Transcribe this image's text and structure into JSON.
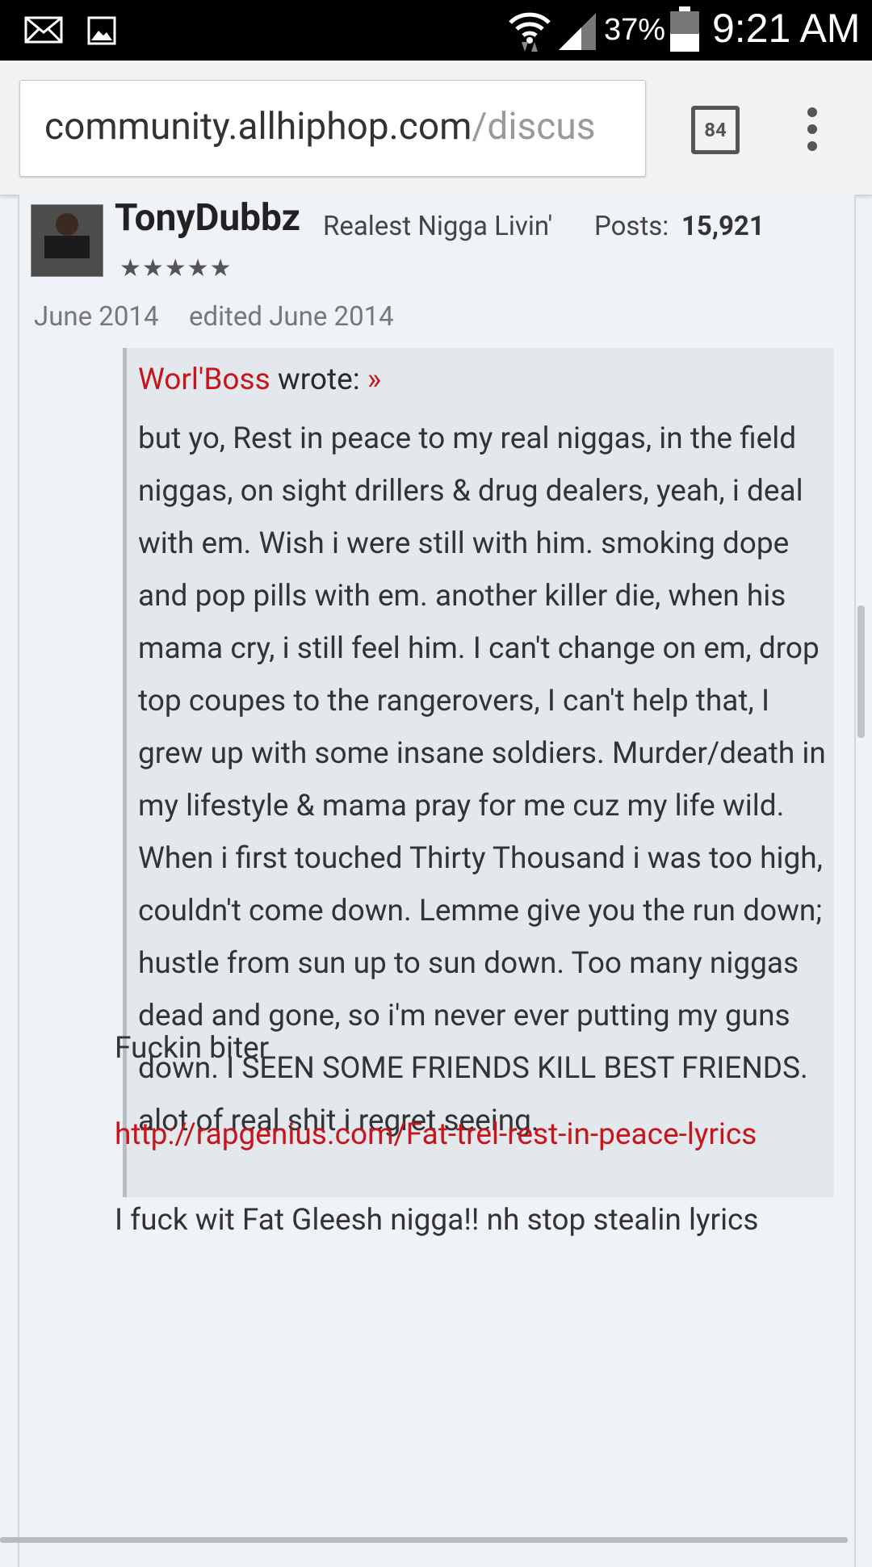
{
  "status_bar": {
    "icons": [
      "mail-icon",
      "image-icon",
      "wifi-icon",
      "signal-icon",
      "battery-icon"
    ],
    "battery": "37%",
    "time": "9:21 AM"
  },
  "browser": {
    "url_host": "community.allhiphop.com",
    "url_path": "/discus",
    "tab_count": "84"
  },
  "post": {
    "username": "TonyDubbz",
    "rank": "Realest Nigga Livin'",
    "posts_label": "Posts:",
    "posts_count": "15,921",
    "stars": "★★★★★",
    "date": "June 2014",
    "edited": "edited June 2014",
    "quote": {
      "author": "Worl'Boss",
      "wrote": "wrote:",
      "arrow": "»",
      "body": "but yo, Rest in peace to my real niggas, in the field niggas, on sight drillers & drug dealers, yeah, i deal with em. Wish i were still with him. smoking dope and pop pills with em. another killer die, when his mama cry, i still feel him. I can't change on em, drop top coupes to the rangerovers, I can't help that, I grew up with some insane soldiers. Murder/death in my lifestyle & mama pray for me cuz my life wild. When i first touched Thirty Thousand i was too high, couldn't come down. Lemme give you the run down; hustle from sun up to sun down. Too many niggas dead and gone, so i'm never ever putting my guns down. I SEEN SOME FRIENDS KILL BEST FRIENDS. alot of real shit i regret seeing."
    },
    "reply_line1": "Fuckin biter",
    "reply_link": "http://rapgenius.com/Fat-trel-rest-in-peace-lyrics",
    "reply_line3": "I fuck wit Fat Gleesh nigga!! nh stop stealin lyrics"
  },
  "colors": {
    "link": "#c8141b",
    "page_bg": "#eef3f8",
    "quote_bg": "#e3e8ed"
  }
}
